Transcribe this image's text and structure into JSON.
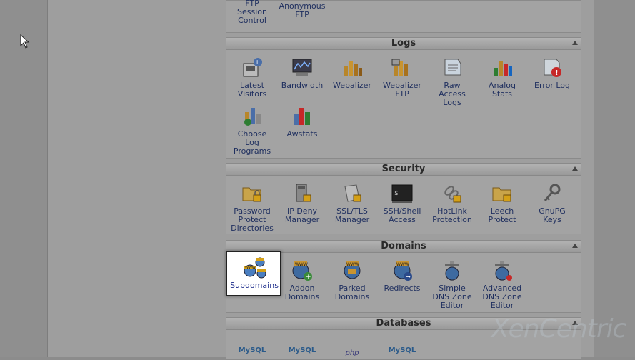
{
  "panels": {
    "logs": {
      "title": "Logs"
    },
    "security": {
      "title": "Security"
    },
    "domains": {
      "title": "Domains"
    },
    "databases": {
      "title": "Databases"
    }
  },
  "ftp_items": {
    "session_control": "FTP Session Control",
    "anonymous": "Anonymous FTP"
  },
  "logs_items": {
    "latest_visitors": "Latest Visitors",
    "bandwidth": "Bandwidth",
    "webalizer": "Webalizer",
    "webalizer_ftp": "Webalizer FTP",
    "raw_access_logs": "Raw Access Logs",
    "analog_stats": "Analog Stats",
    "error_log": "Error Log",
    "choose_log_programs": "Choose Log Programs",
    "awstats": "Awstats"
  },
  "security_items": {
    "password_protect": "Password Protect Directories",
    "ip_deny": "IP Deny Manager",
    "ssl_tls": "SSL/TLS Manager",
    "ssh_shell": "SSH/Shell Access",
    "hotlink": "HotLink Protection",
    "leech": "Leech Protect",
    "gnupg": "GnuPG Keys"
  },
  "domains_items": {
    "subdomains": "Subdomains",
    "addon": "Addon Domains",
    "parked": "Parked Domains",
    "redirects": "Redirects",
    "simple_dns": "Simple DNS Zone Editor",
    "advanced_dns": "Advanced DNS Zone Editor"
  },
  "database_items": {
    "mysql1": "MySQL",
    "mysql2": "MySQL",
    "php": "php",
    "mysql3": "MySQL"
  },
  "watermark": "XenCentric",
  "colors": {
    "link": "#1f2f5f",
    "panel_bg": "#a3a3a3",
    "highlight": "#ffffff"
  }
}
